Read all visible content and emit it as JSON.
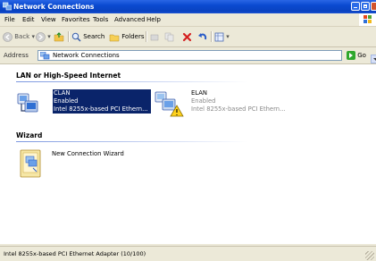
{
  "window": {
    "title": "Network Connections"
  },
  "menu": [
    "File",
    "Edit",
    "View",
    "Favorites",
    "Tools",
    "Advanced",
    "Help"
  ],
  "toolbar": {
    "back": "Back",
    "search": "Search",
    "folders": "Folders"
  },
  "address": {
    "label": "Address",
    "value": "Network Connections",
    "go": "Go"
  },
  "groups": {
    "lan": {
      "heading": "LAN or High-Speed Internet",
      "items": [
        {
          "name": "CLAN",
          "status": "Enabled",
          "device": "Intel 8255x-based PCI Ethern...",
          "selected": true
        },
        {
          "name": "ELAN",
          "status": "Enabled",
          "device": "Intel 8255x-based PCI Ethern...",
          "selected": false
        }
      ]
    },
    "wizard": {
      "heading": "Wizard",
      "items": [
        {
          "name": "New Connection Wizard"
        }
      ]
    }
  },
  "status": "Intel 8255x-based PCI Ethernet Adapter (10/100)",
  "colors": {
    "titlebar": "#0a4ad0",
    "selection": "#0a246a",
    "content_bg": "#ffffff",
    "chrome": "#ece9d8"
  }
}
